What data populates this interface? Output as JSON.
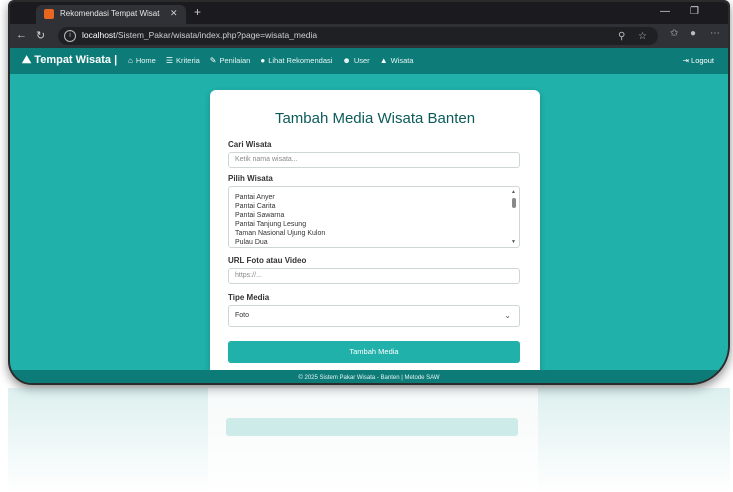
{
  "browser": {
    "tab_title": "Rekomendasi Tempat Wisata di I...",
    "url_host": "localhost",
    "url_path": "/Sistem_Pakar/wisata/index.php?page=wisata_media"
  },
  "nav": {
    "brand": "Tempat Wisata |",
    "items": [
      {
        "label": "Home",
        "icon": "home-icon"
      },
      {
        "label": "Kriteria",
        "icon": "list-icon"
      },
      {
        "label": "Penilaian",
        "icon": "edit-icon"
      },
      {
        "label": "Lihat Rekomendasi",
        "icon": "pin-icon"
      },
      {
        "label": "User",
        "icon": "users-icon"
      },
      {
        "label": "Wisata",
        "icon": "mountain-icon"
      }
    ],
    "logout": "Logout"
  },
  "form": {
    "title": "Tambah Media Wisata Banten",
    "search_label": "Cari Wisata",
    "search_placeholder": "Ketik nama wisata...",
    "choose_label": "Pilih Wisata",
    "options": [
      "Pantai Anyer",
      "Pantai Carita",
      "Pantai Sawarna",
      "Pantai Tanjung Lesung",
      "Taman Nasional Ujung Kulon",
      "Pulau Dua"
    ],
    "url_label": "URL Foto atau Video",
    "url_placeholder": "https://...",
    "type_label": "Tipe Media",
    "type_value": "Foto",
    "submit": "Tambah Media"
  },
  "footer": "© 2025 Sistem Pakar Wisata - Banten | Metode SAW"
}
